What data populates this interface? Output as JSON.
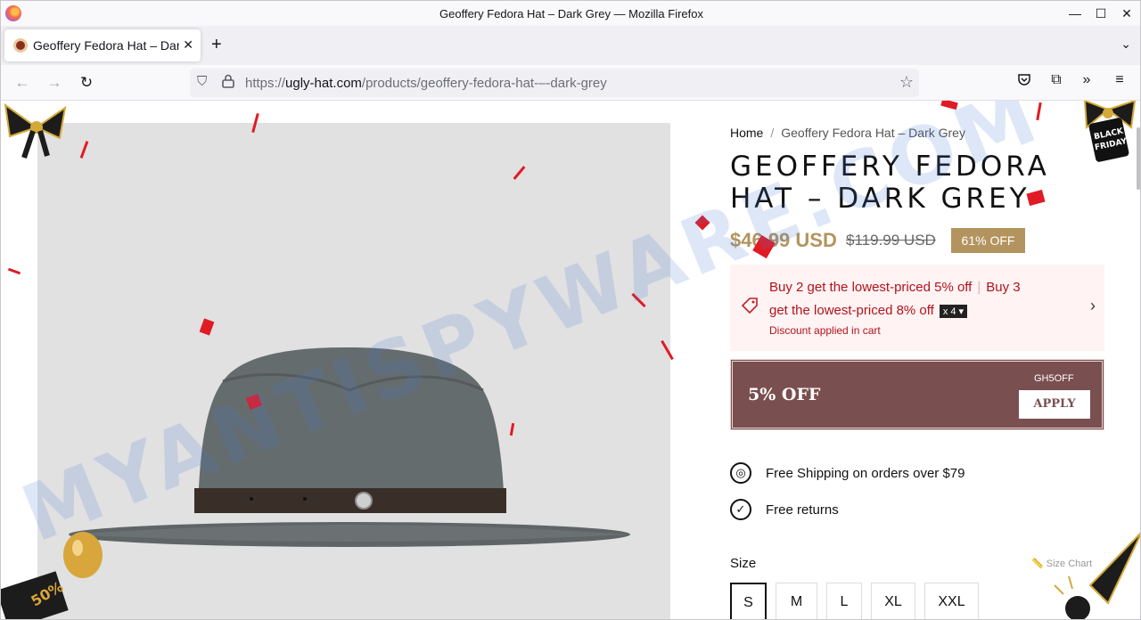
{
  "browser": {
    "window_title": "Geoffery Fedora Hat – Dark Grey — Mozilla Firefox",
    "tab_title": "Geoffery Fedora Hat – Dark Grey",
    "url_prefix": "https://",
    "url_host": "ugly-hat.com",
    "url_path": "/products/geoffery-fedora-hat-–-dark-grey"
  },
  "breadcrumb": {
    "home": "Home",
    "sep": "/",
    "current": "Geoffery Fedora Hat – Dark Grey"
  },
  "product": {
    "title": "GEOFFERY FEDORA HAT – DARK GREY",
    "price": "$46.99 USD",
    "compare_price": "$119.99 USD",
    "discount_badge": "61% OFF"
  },
  "promo": {
    "line1_a": "Buy 2 get the lowest-priced 5% off",
    "line1_sep": "|",
    "line1_b": "Buy 3",
    "line2": "get the lowest-priced 8% off",
    "qty_badge": "x 4 ▾",
    "note": "Discount applied in cart"
  },
  "coupon": {
    "label": "5% OFF",
    "code": "GH5OFF",
    "apply": "APPLY"
  },
  "features": {
    "shipping": "Free Shipping on orders over $79",
    "returns": "Free returns"
  },
  "size": {
    "label": "Size",
    "chart": "Size Chart",
    "options": [
      "S",
      "M",
      "L",
      "XL",
      "XXL"
    ],
    "selected": "S"
  },
  "decor": {
    "badge_line1": "BLACK",
    "badge_line2": "FRIDAY",
    "balloon_text": "50%"
  },
  "watermark": "MYANTISPYWARE.COM",
  "colors": {
    "accent_gold": "#b3945e",
    "promo_red": "#b0131d",
    "coupon_bg": "#7a4f4f"
  }
}
